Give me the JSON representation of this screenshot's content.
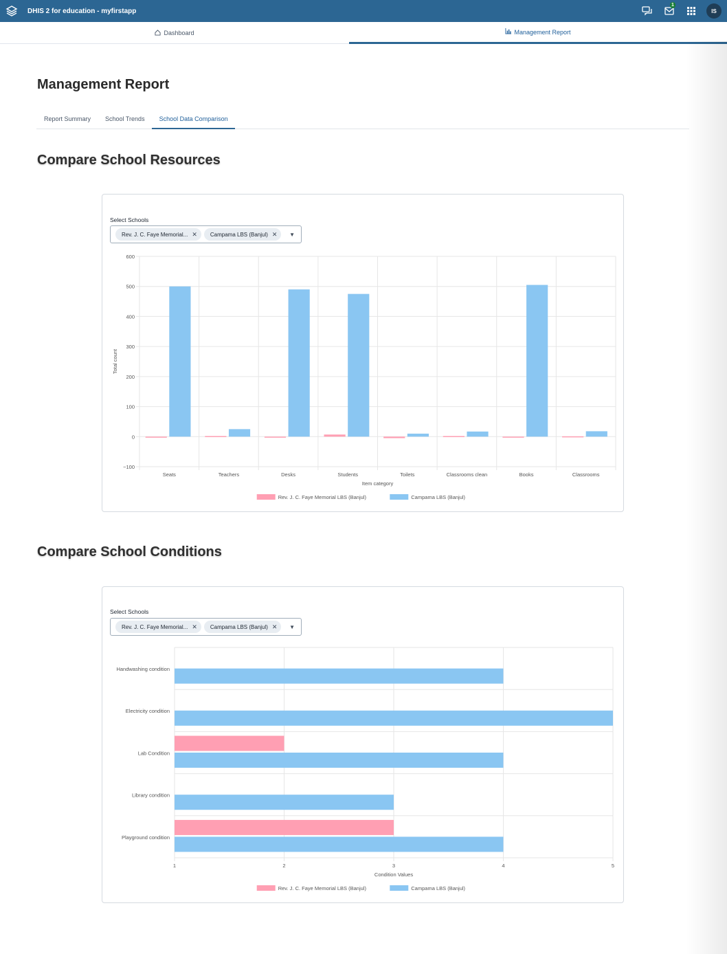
{
  "header": {
    "app_title": "DHIS 2 for education - myfirstapp",
    "messages_badge": "1",
    "user_initials": "IS",
    "icons": [
      "dhis2-logo-icon",
      "interpretations-icon",
      "messages-icon",
      "apps-grid-icon"
    ]
  },
  "app_nav": {
    "tabs": [
      {
        "label": "Dashboard",
        "icon": "home-icon",
        "active": false
      },
      {
        "label": "Management Report",
        "icon": "bar-chart-icon",
        "active": true
      }
    ]
  },
  "page": {
    "title": "Management Report",
    "tabs": [
      {
        "label": "Report Summary",
        "active": false
      },
      {
        "label": "School Trends",
        "active": false
      },
      {
        "label": "School Data Comparison",
        "active": true
      }
    ]
  },
  "resources": {
    "title": "Compare School Resources",
    "select_label": "Select Schools",
    "selected": [
      "Rev. J. C. Faye Memorial...",
      "Campama LBS (Banjul)"
    ]
  },
  "conditions": {
    "title": "Compare School Conditions",
    "select_label": "Select Schools",
    "selected": [
      "Rev. J. C. Faye Memorial...",
      "Campama LBS (Banjul)"
    ]
  },
  "colors": {
    "header_bg": "#2c6693",
    "series_pink": "#ff9fb3",
    "series_blue": "#8ac6f2"
  },
  "chart_data": [
    {
      "type": "bar",
      "orientation": "vertical",
      "categories": [
        "Seats",
        "Teachers",
        "Desks",
        "Students",
        "Toilets",
        "Classrooms clean",
        "Books",
        "Classrooms"
      ],
      "series": [
        {
          "name": "Rev. J. C. Faye Memorial LBS (Banjul)",
          "values": [
            0,
            2,
            -3,
            7,
            -5,
            2,
            -1,
            1
          ]
        },
        {
          "name": "Campama LBS (Banjul)",
          "values": [
            500,
            25,
            490,
            475,
            10,
            17,
            505,
            18
          ]
        }
      ],
      "xlabel": "Item category",
      "ylabel": "Total count",
      "ylim": [
        -100,
        600
      ],
      "yticks": [
        "600",
        "500",
        "400",
        "300",
        "200",
        "100",
        "0",
        "−100"
      ],
      "grid": true,
      "legend": "bottom"
    },
    {
      "type": "bar",
      "orientation": "horizontal",
      "categories": [
        "Handwashing condition",
        "Electricity condition",
        "Lab Condition",
        "Library condition",
        "Playground condition"
      ],
      "series": [
        {
          "name": "Rev. J. C. Faye Memorial LBS (Banjul)",
          "values": [
            null,
            null,
            2,
            null,
            3
          ]
        },
        {
          "name": "Campama LBS (Banjul)",
          "values": [
            4,
            5,
            4,
            3,
            4
          ]
        }
      ],
      "xlabel": "Condition Values",
      "ylabel": "",
      "xlim": [
        1,
        5
      ],
      "xticks": [
        "1",
        "2",
        "3",
        "4",
        "5"
      ],
      "grid": true,
      "legend": "bottom"
    }
  ]
}
